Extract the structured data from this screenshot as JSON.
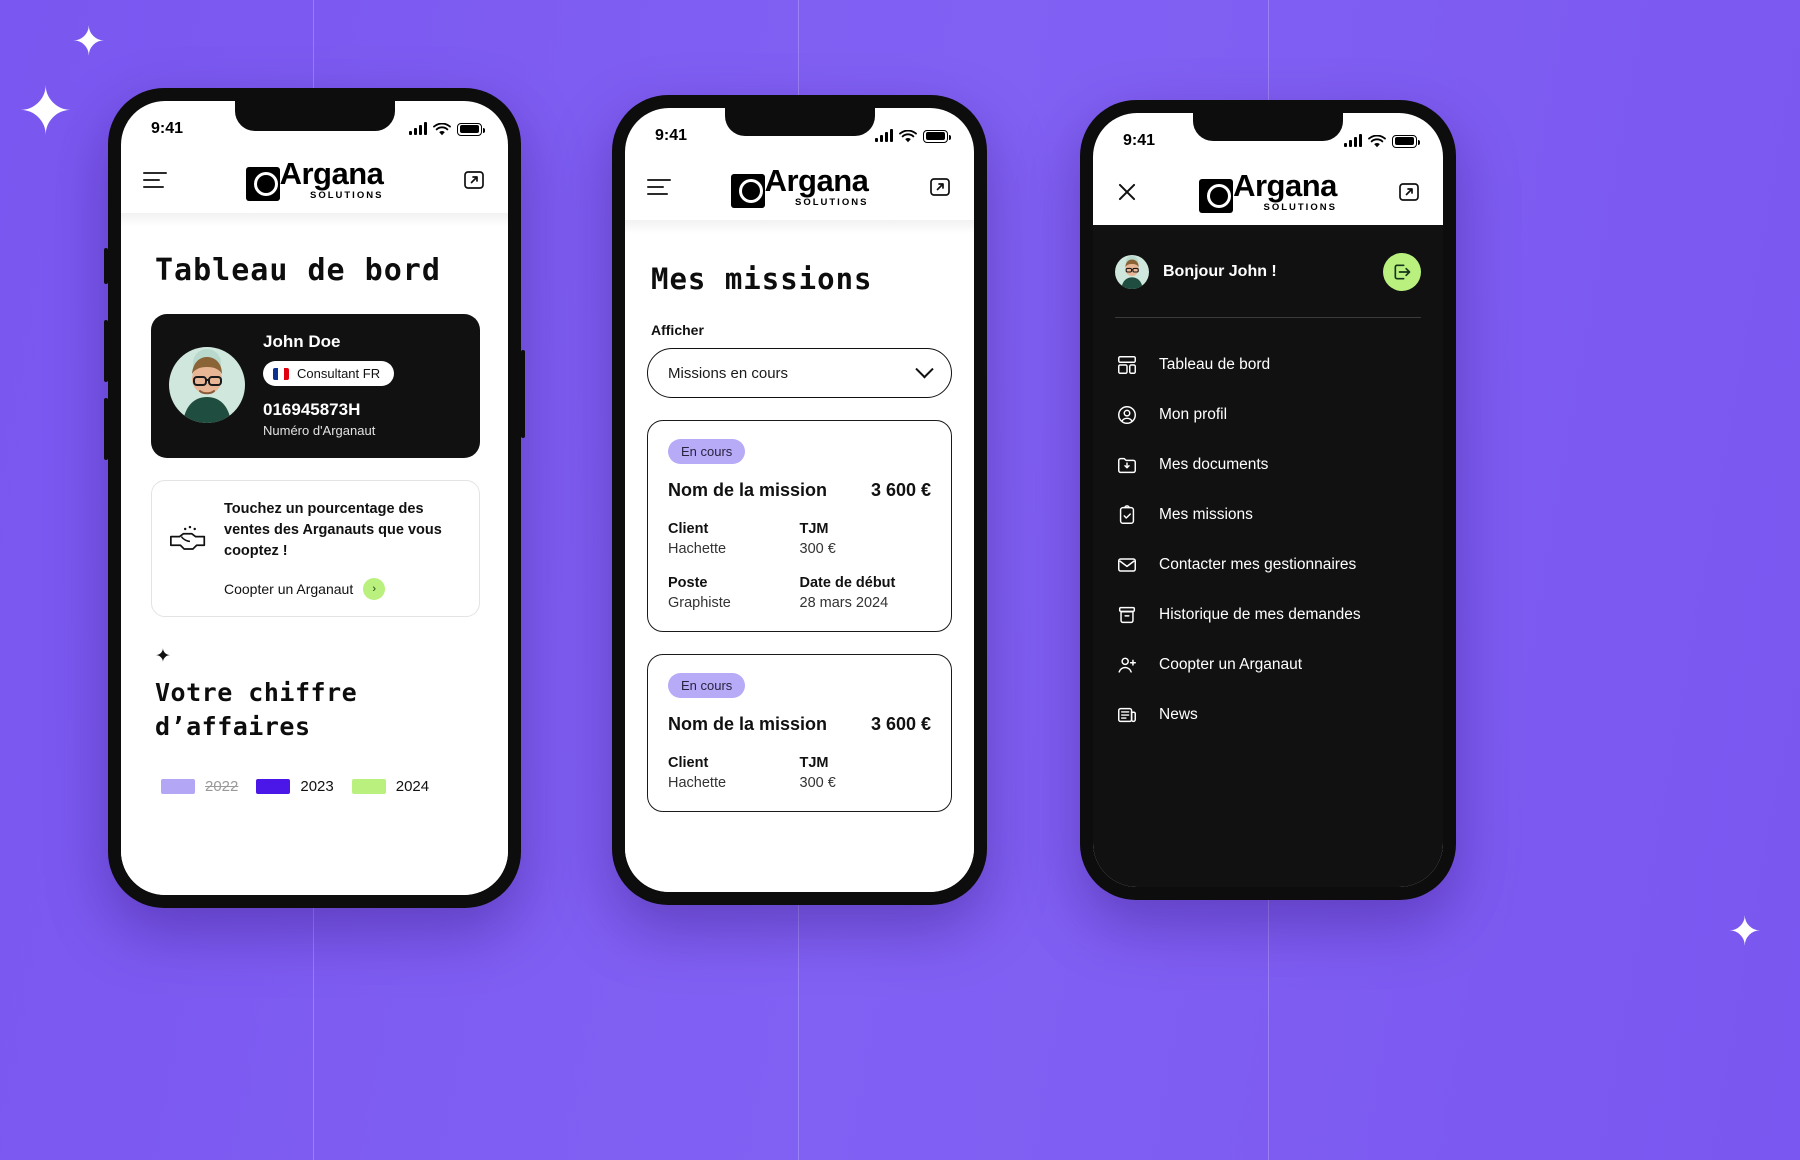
{
  "background": {
    "accent": "#7c5cf0",
    "green": "#b9f07e",
    "lilac": "#b7aaf7"
  },
  "status_bar": {
    "time": "9:41",
    "signal_icon": "cellular-bars-icon",
    "wifi_icon": "wifi-icon",
    "battery_icon": "battery-icon"
  },
  "brand": {
    "name": "Argana",
    "tagline": "SOLUTIONS"
  },
  "screen1": {
    "title": "Tableau de bord",
    "profile": {
      "name": "John Doe",
      "role_badge": "Consultant FR",
      "flag": "flag-fr-icon",
      "number": "016945873H",
      "number_label": "Numéro d'Arganaut"
    },
    "cooptation": {
      "icon": "handshake-money-icon",
      "text": "Touchez un pourcentage des ventes des Arganauts que vous cooptez !",
      "link_label": "Coopter un Arganaut",
      "arrow": "chevron-right-icon"
    },
    "revenue": {
      "star": "✦",
      "title": "Votre chiffre d’affaires",
      "legend": [
        {
          "label": "2022",
          "color": "#b3a6f5",
          "disabled": true
        },
        {
          "label": "2023",
          "color": "#4b17e8",
          "disabled": false
        },
        {
          "label": "2024",
          "color": "#b9f07e",
          "disabled": false
        }
      ]
    }
  },
  "screen2": {
    "title": "Mes missions",
    "filter_label": "Afficher",
    "filter_value": "Missions en cours",
    "missions": [
      {
        "status": "En cours",
        "name": "Nom de la mission",
        "price": "3 600 €",
        "client_label": "Client",
        "client_value": "Hachette",
        "tjm_label": "TJM",
        "tjm_value": "300 €",
        "poste_label": "Poste",
        "poste_value": "Graphiste",
        "start_label": "Date de début",
        "start_value": "28 mars 2024"
      },
      {
        "status": "En cours",
        "name": "Nom de la mission",
        "price": "3 600 €",
        "client_label": "Client",
        "client_value": "Hachette",
        "tjm_label": "TJM",
        "tjm_value": "300 €",
        "poste_label": "",
        "poste_value": "",
        "start_label": "",
        "start_value": ""
      }
    ]
  },
  "screen3": {
    "greeting": "Bonjour John !",
    "logout_icon": "logout-icon",
    "close_icon": "close-icon",
    "menu": [
      {
        "label": "Tableau de bord",
        "icon": "dashboard-icon"
      },
      {
        "label": "Mon profil",
        "icon": "user-circle-icon"
      },
      {
        "label": "Mes documents",
        "icon": "folder-download-icon"
      },
      {
        "label": "Mes missions",
        "icon": "clipboard-check-icon"
      },
      {
        "label": "Contacter mes gestionnaires",
        "icon": "mail-icon"
      },
      {
        "label": "Historique de mes demandes",
        "icon": "archive-icon"
      },
      {
        "label": "Coopter un Arganaut",
        "icon": "user-plus-icon"
      },
      {
        "label": "News",
        "icon": "news-icon"
      }
    ]
  }
}
